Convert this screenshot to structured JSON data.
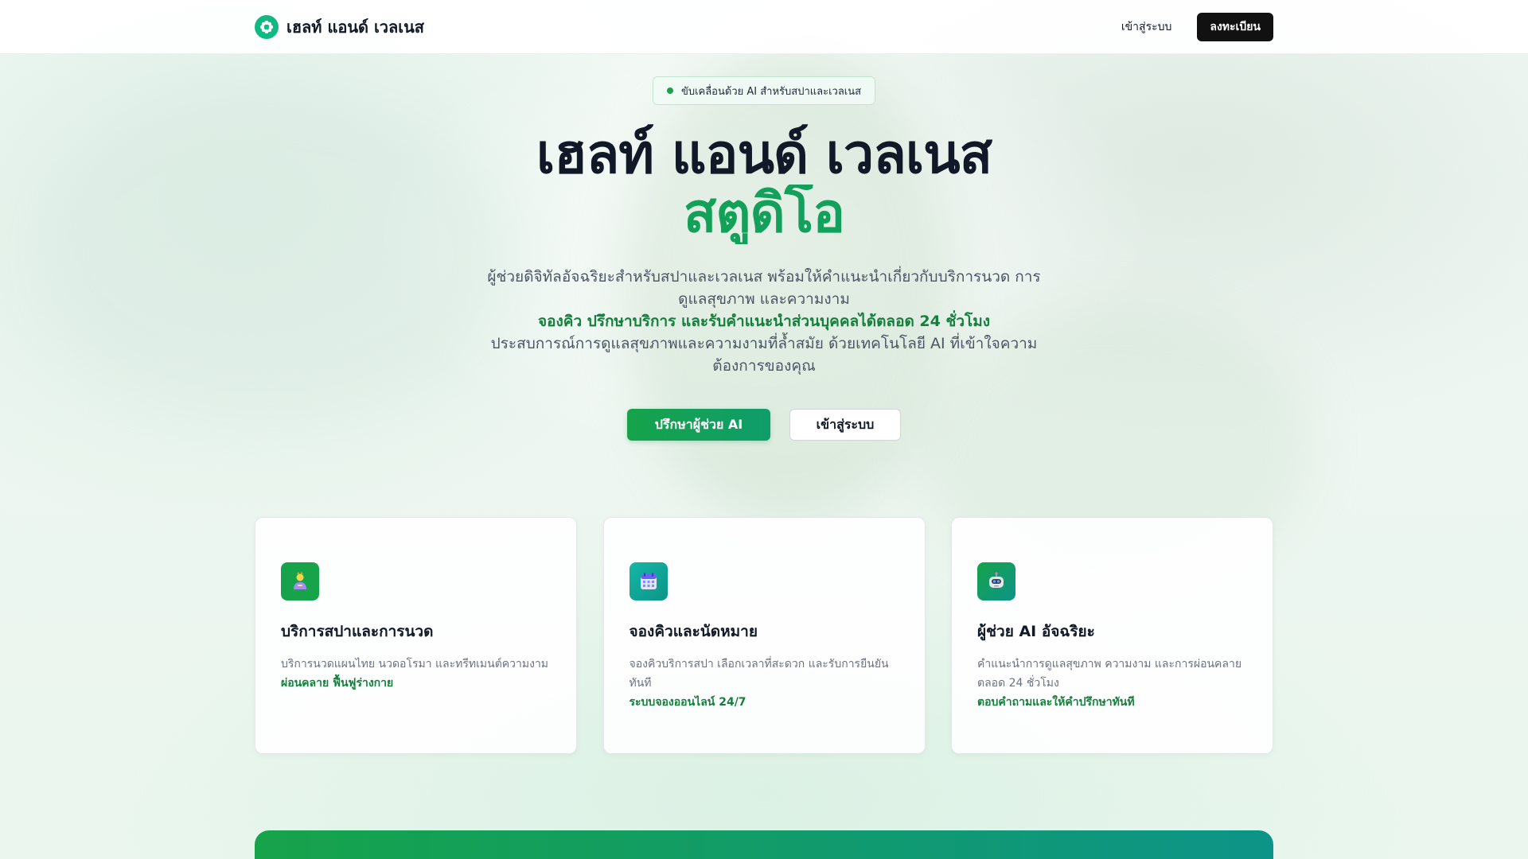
{
  "nav": {
    "brand_name": "เฮลท์ แอนด์ เวลเนส",
    "login_label": "เข้าสู่ระบบ",
    "register_label": "ลงทะเบียน"
  },
  "hero": {
    "badge": "ขับเคลื่อนด้วย AI สำหรับสปาและเวลเนส",
    "title_line1": "เฮลท์ แอนด์ เวลเนส",
    "title_line2": "สตูดิโอ",
    "desc_line1": "ผู้ช่วยดิจิทัลอัจฉริยะสำหรับสปาและเวลเนส พร้อมให้คำแนะนำเกี่ยวกับบริการนวด การดูแลสุขภาพ และความงาม",
    "desc_highlight": "จองคิว ปรึกษาบริการ และรับคำแนะนำส่วนบุคคลได้ตลอด 24 ชั่วโมง",
    "desc_line2": "ประสบการณ์การดูแลสุขภาพและความงามที่ล้ำสมัย ด้วยเทคโนโลยี AI ที่เข้าใจความต้องการของคุณ",
    "primary_button": "ปรึกษาผู้ช่วย AI",
    "secondary_button": "เข้าสู่ระบบ"
  },
  "cards": [
    {
      "icon": "massage-person-icon",
      "title": "บริการสปาและการนวด",
      "desc": "บริการนวดแผนไทย นวดอโรมา และทรีทเมนต์ความงาม",
      "highlight": "ผ่อนคลาย ฟื้นฟูร่างกาย"
    },
    {
      "icon": "calendar-icon",
      "title": "จองคิวและนัดหมาย",
      "desc": "จองคิวบริการสปา เลือกเวลาที่สะดวก และรับการยืนยันทันที",
      "highlight": "ระบบจองออนไลน์ 24/7"
    },
    {
      "icon": "robot-icon",
      "title": "ผู้ช่วย AI อัจฉริยะ",
      "desc": "คำแนะนำการดูแลสุขภาพ ความงาม และการผ่อนคลายตลอด 24 ชั่วโมง",
      "highlight": "ตอบคำถามและให้คำปรึกษาทันที"
    }
  ],
  "colors": {
    "accent": "#16a34a",
    "accent_teal": "#0d9488",
    "dark": "#111111"
  }
}
